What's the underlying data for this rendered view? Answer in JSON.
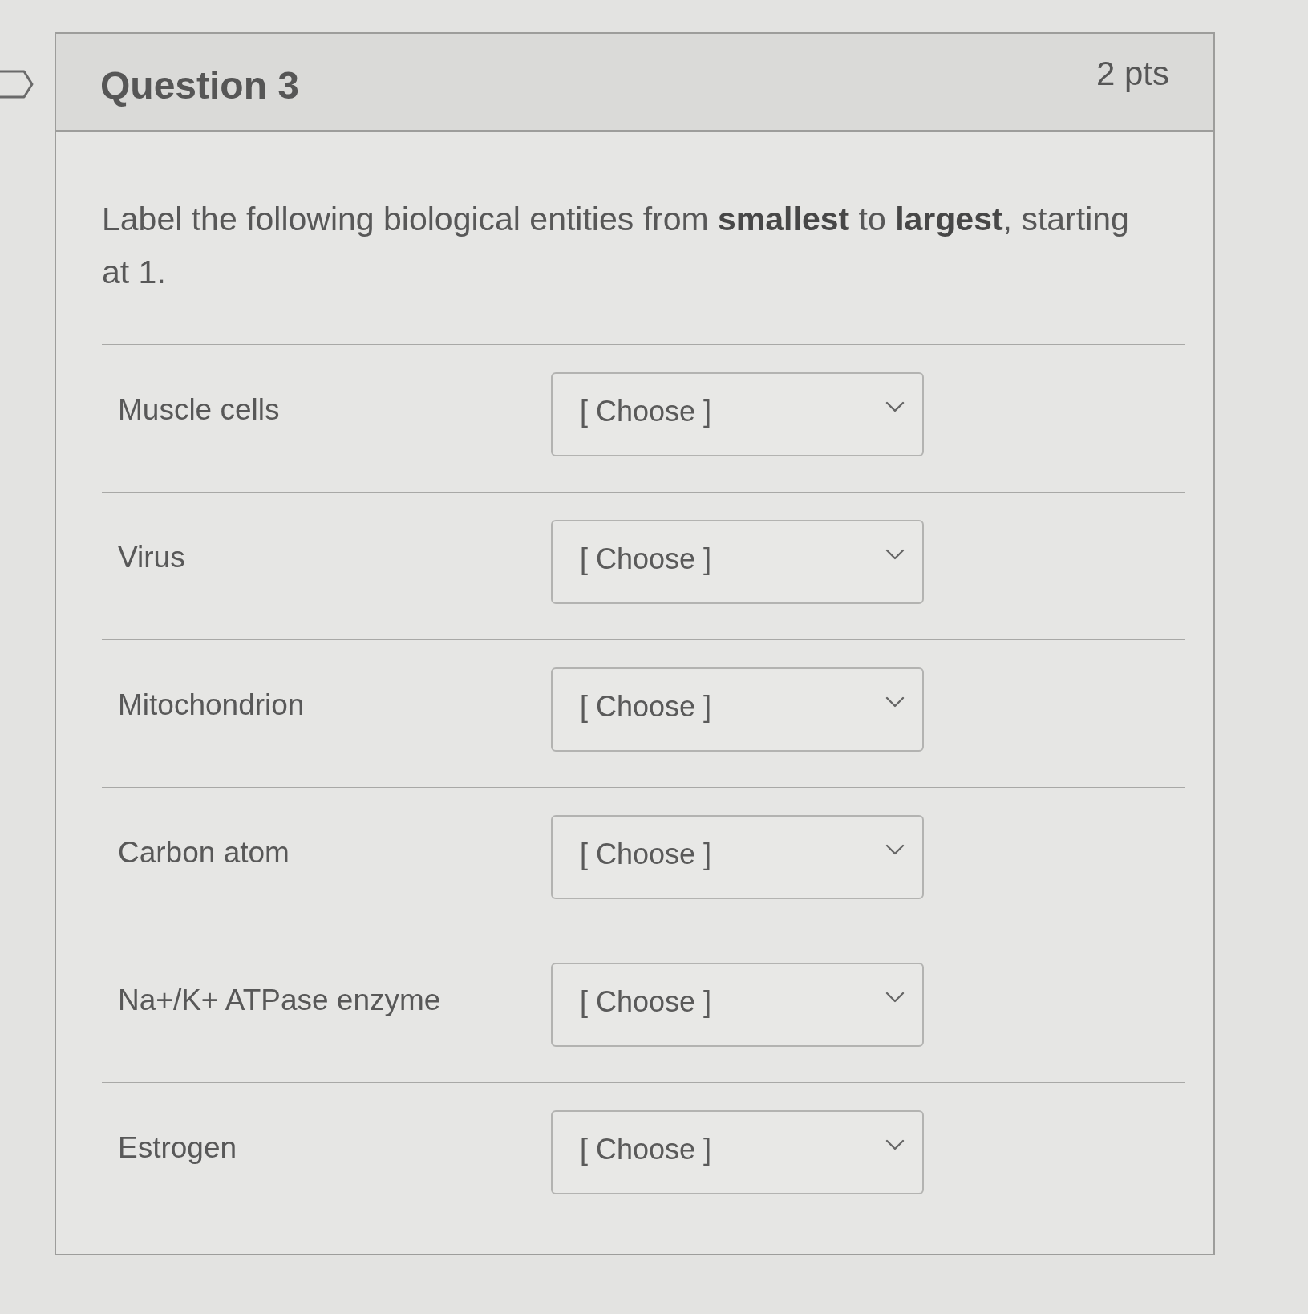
{
  "question": {
    "title": "Question 3",
    "points": "2 pts"
  },
  "prompt": "Label the following biological entities from **smallest** to **largest**, starting at 1.",
  "items": [
    {
      "label": "Muscle cells",
      "value": "[ Choose ]"
    },
    {
      "label": "Virus",
      "value": "[ Choose ]"
    },
    {
      "label": "Mitochondrion",
      "value": "[ Choose ]"
    },
    {
      "label": "Carbon atom",
      "value": "[ Choose ]"
    },
    {
      "label": "Na+/K+ ATPase enzyme",
      "value": "[ Choose ]"
    },
    {
      "label": "Estrogen",
      "value": "[ Choose ]"
    }
  ]
}
